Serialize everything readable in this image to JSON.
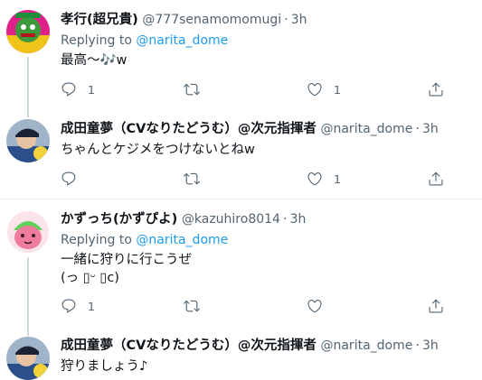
{
  "tweets": [
    {
      "display_name": "孝行(超兄貴)",
      "handle": "@777senamomomugi",
      "time": "3h",
      "replying_prefix": "Replying to",
      "replying_to": "@narita_dome",
      "text_lines": [
        "最高～🎶w"
      ],
      "reply_count": "1",
      "retweet_count": "",
      "like_count": "1"
    },
    {
      "display_name": "成田童夢（CVなりたどうむ）@次元指揮者",
      "handle": "@narita_dome",
      "time": "3h",
      "text_lines": [
        "ちゃんとケジメをつけないとねw"
      ],
      "reply_count": "",
      "retweet_count": "",
      "like_count": "1"
    },
    {
      "display_name": "かずっち(かずぴよ)",
      "handle": "@kazuhiro8014",
      "time": "3h",
      "replying_prefix": "Replying to",
      "replying_to": "@narita_dome",
      "text_lines": [
        "一緒に狩りに行こうぜ",
        "(っ ▯ᵕ ▯c)"
      ],
      "reply_count": "1",
      "retweet_count": "",
      "like_count": ""
    },
    {
      "display_name": "成田童夢（CVなりたどうむ）@次元指揮者",
      "handle": "@narita_dome",
      "time": "3h",
      "text_lines": [
        "狩りましょう♪"
      ]
    }
  ],
  "colors": {
    "accent": "#1d9bf0",
    "secondary_text": "#536471",
    "thread_line": "#cfd9de"
  },
  "icons": [
    "reply-icon",
    "retweet-icon",
    "like-icon",
    "share-icon"
  ]
}
